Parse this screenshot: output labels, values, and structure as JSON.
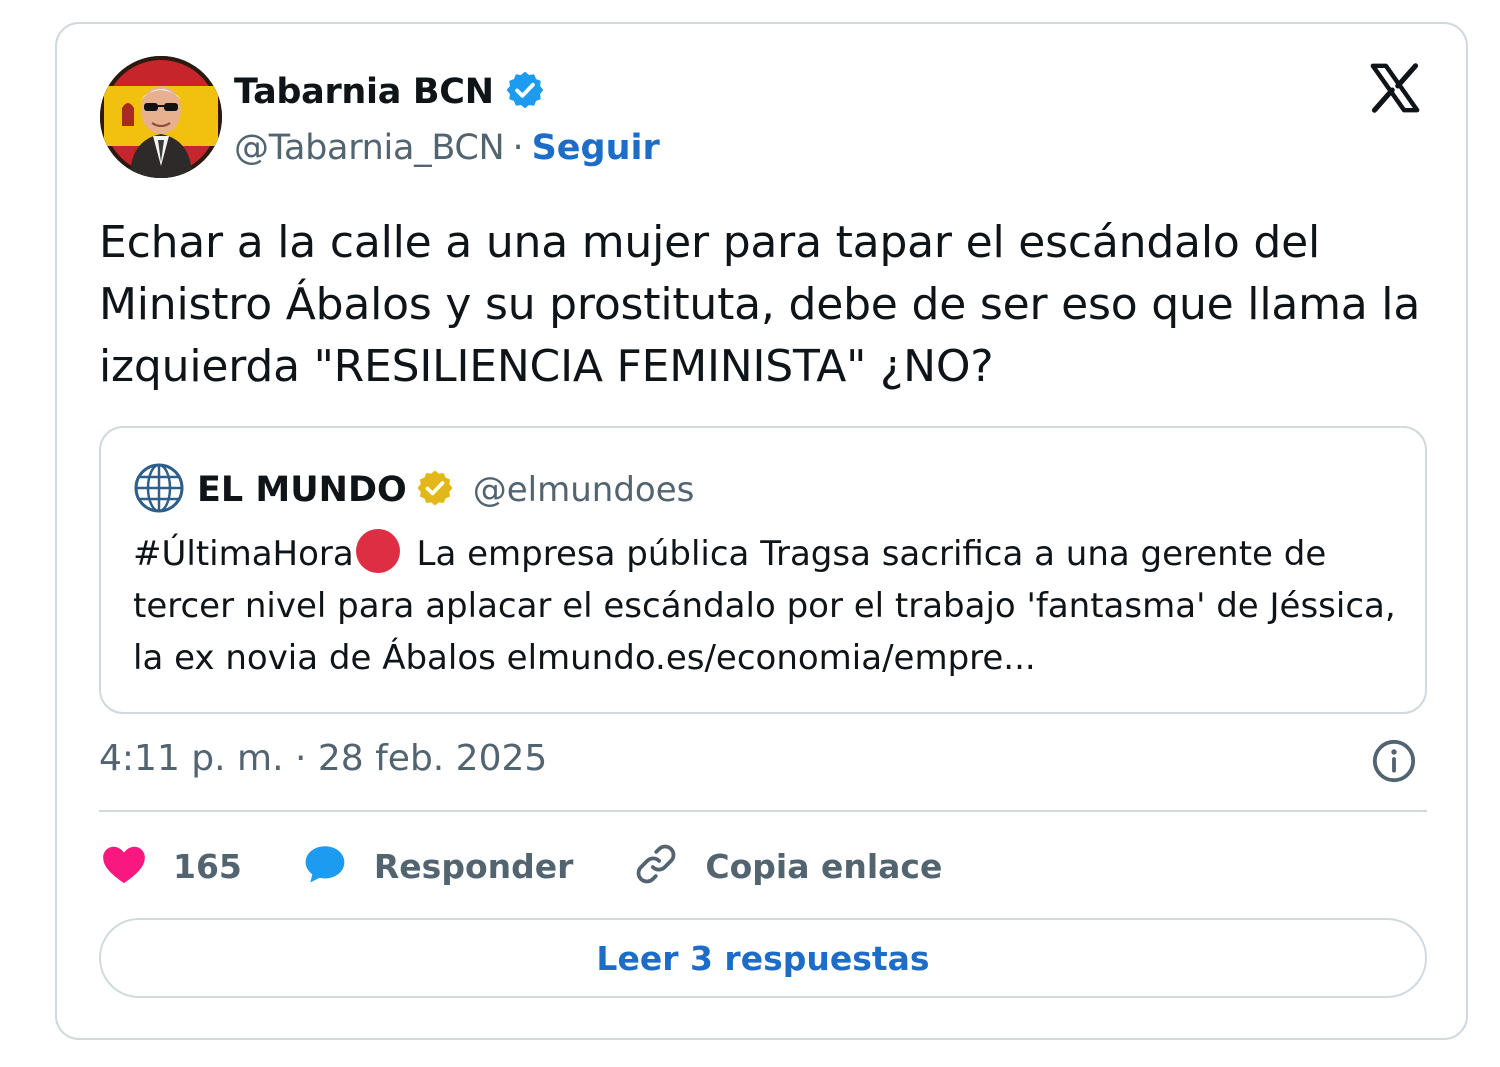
{
  "author": {
    "display_name": "Tabarnia BCN",
    "handle": "@Tabarnia_BCN",
    "separator": "·",
    "follow_label": "Seguir"
  },
  "tweet": {
    "text": "Echar a la calle a una mujer para tapar el escándalo del Ministro Ábalos y su prostituta, debe de ser eso que llama la izquierda \"RESILIENCIA FEMINISTA\" ¿NO?",
    "timestamp": "4:11 p. m. · 28 feb. 2025"
  },
  "quoted": {
    "display_name": "EL MUNDO",
    "handle": "@elmundoes",
    "hashtag": "#ÚltimaHora",
    "text": "La empresa pública Tragsa sacrifica a una gerente de tercer nivel para aplacar el escándalo por el trabajo 'fantasma' de Jéssica, la ex novia de Ábalos elmundo.es/economia/empre..."
  },
  "actions": {
    "likes_count": "165",
    "reply_label": "Responder",
    "copy_link_label": "Copia enlace"
  },
  "read_replies_label": "Leer 3 respuestas",
  "colors": {
    "link_blue": "#1d6cc8",
    "verified_blue": "#1d9bf0",
    "verified_gold": "#e2b719",
    "like_pink": "#f91880",
    "muted_text": "#536471",
    "border": "#cfd9de"
  },
  "icons": [
    "verified-badge-icon",
    "x-logo-icon",
    "globe-icon",
    "gold-verified-badge-icon",
    "red-circle-emoji",
    "info-icon",
    "heart-icon",
    "reply-bubble-icon",
    "link-icon"
  ]
}
